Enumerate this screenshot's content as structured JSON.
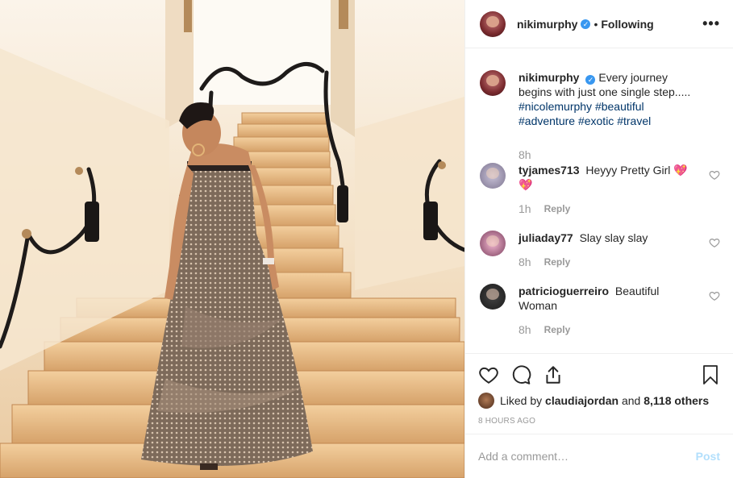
{
  "post": {
    "author": "nikimurphy",
    "following_label": "Following",
    "more_label": "•••",
    "separator": "•"
  },
  "caption": {
    "username": "nikimurphy",
    "text": "Every journey begins with just one single step.....",
    "hashtags": [
      "#nicolemurphy",
      "#beautiful",
      "#adventure",
      "#exotic",
      "#travel"
    ],
    "age": "8h"
  },
  "comments": [
    {
      "username": "tyjames713",
      "text": "Heyyy Pretty Girl 💖💖",
      "age": "1h",
      "reply_label": "Reply"
    },
    {
      "username": "juliaday77",
      "text": "Slay slay slay",
      "age": "8h",
      "reply_label": "Reply"
    },
    {
      "username": "patricioguerreiro",
      "text": "Beautiful Woman",
      "age": "8h",
      "reply_label": "Reply"
    }
  ],
  "likes": {
    "prefix": "Liked by",
    "user": "claudiajordan",
    "conjunction": "and",
    "others": "8,118 others"
  },
  "timestamp": "8 HOURS AGO",
  "comment_box": {
    "placeholder": "Add a comment…",
    "post_label": "Post"
  },
  "icons": {
    "like": "heart-icon",
    "comment": "comment-bubble-icon",
    "share": "share-icon",
    "save": "bookmark-icon",
    "verified": "verified-badge-icon"
  },
  "colors": {
    "verified": "#3897f0",
    "hashtag": "#003569",
    "muted": "#999999",
    "post_disabled": "#b2dffc"
  }
}
